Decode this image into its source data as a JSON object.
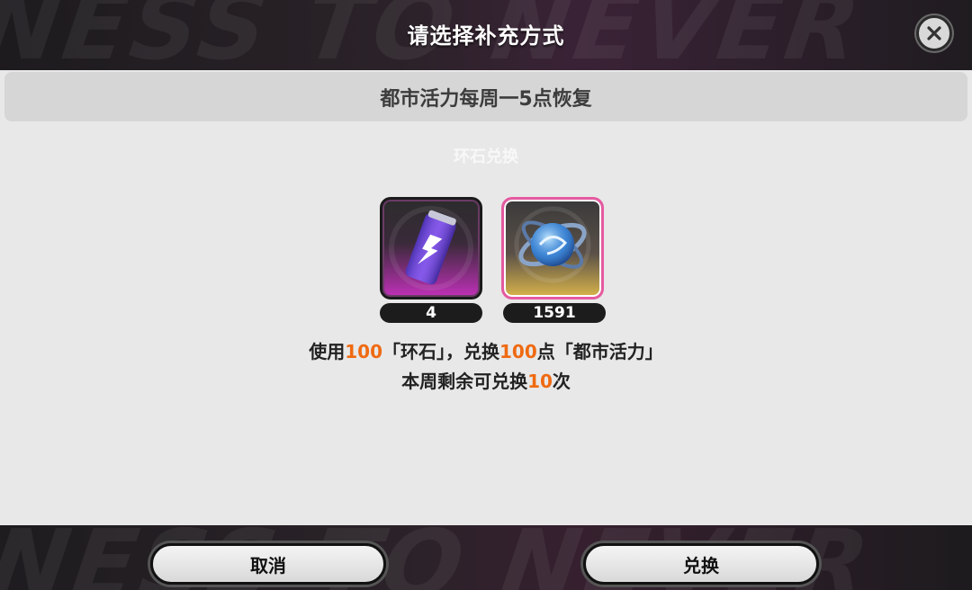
{
  "header": {
    "title": "请选择补充方式",
    "bg_text": "NESS TO NEVER"
  },
  "banner": {
    "text": "都市活力每周一5点恢复"
  },
  "faint_text": "环石兑换",
  "items": [
    {
      "name": "energy-drink",
      "count": "4"
    },
    {
      "name": "polychrome",
      "count": "1591"
    }
  ],
  "description": {
    "line1_parts": [
      "使用",
      "100",
      "「环石」，兑换",
      "100",
      "点「都市活力」"
    ],
    "line2_parts": [
      "本周剩余可兑换",
      "10",
      "次"
    ]
  },
  "buttons": {
    "cancel": "取消",
    "confirm": "兑换"
  },
  "colors": {
    "highlight": "#ef6a12",
    "selected_border": "#e55aa0"
  },
  "footer": {
    "bg_text": "NESS TO NEVER"
  }
}
